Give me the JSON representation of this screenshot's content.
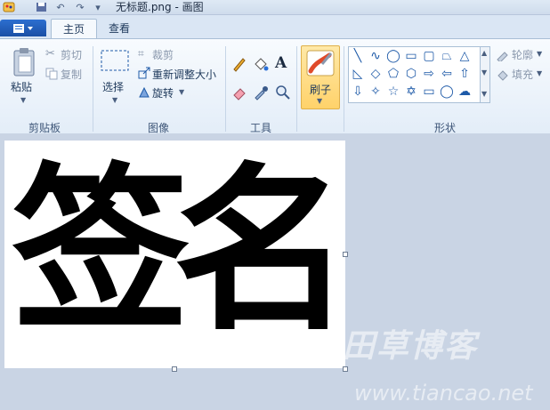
{
  "window": {
    "title": "无标题.png - 画图"
  },
  "tabs": [
    {
      "label": "主页"
    },
    {
      "label": "查看"
    }
  ],
  "clipboard": {
    "paste": "粘贴",
    "cut": "剪切",
    "copy": "复制",
    "group": "剪贴板"
  },
  "image": {
    "select": "选择",
    "crop": "裁剪",
    "resize": "重新调整大小",
    "rotate": "旋转",
    "group": "图像"
  },
  "tools": {
    "group": "工具"
  },
  "brushes": {
    "label": "刷子"
  },
  "shapes": {
    "outline": "轮廓",
    "fill": "填充",
    "group": "形状"
  },
  "canvas": {
    "text": "签名"
  },
  "watermark": {
    "logo": "田草博客",
    "url": "www.tiancao.net"
  }
}
